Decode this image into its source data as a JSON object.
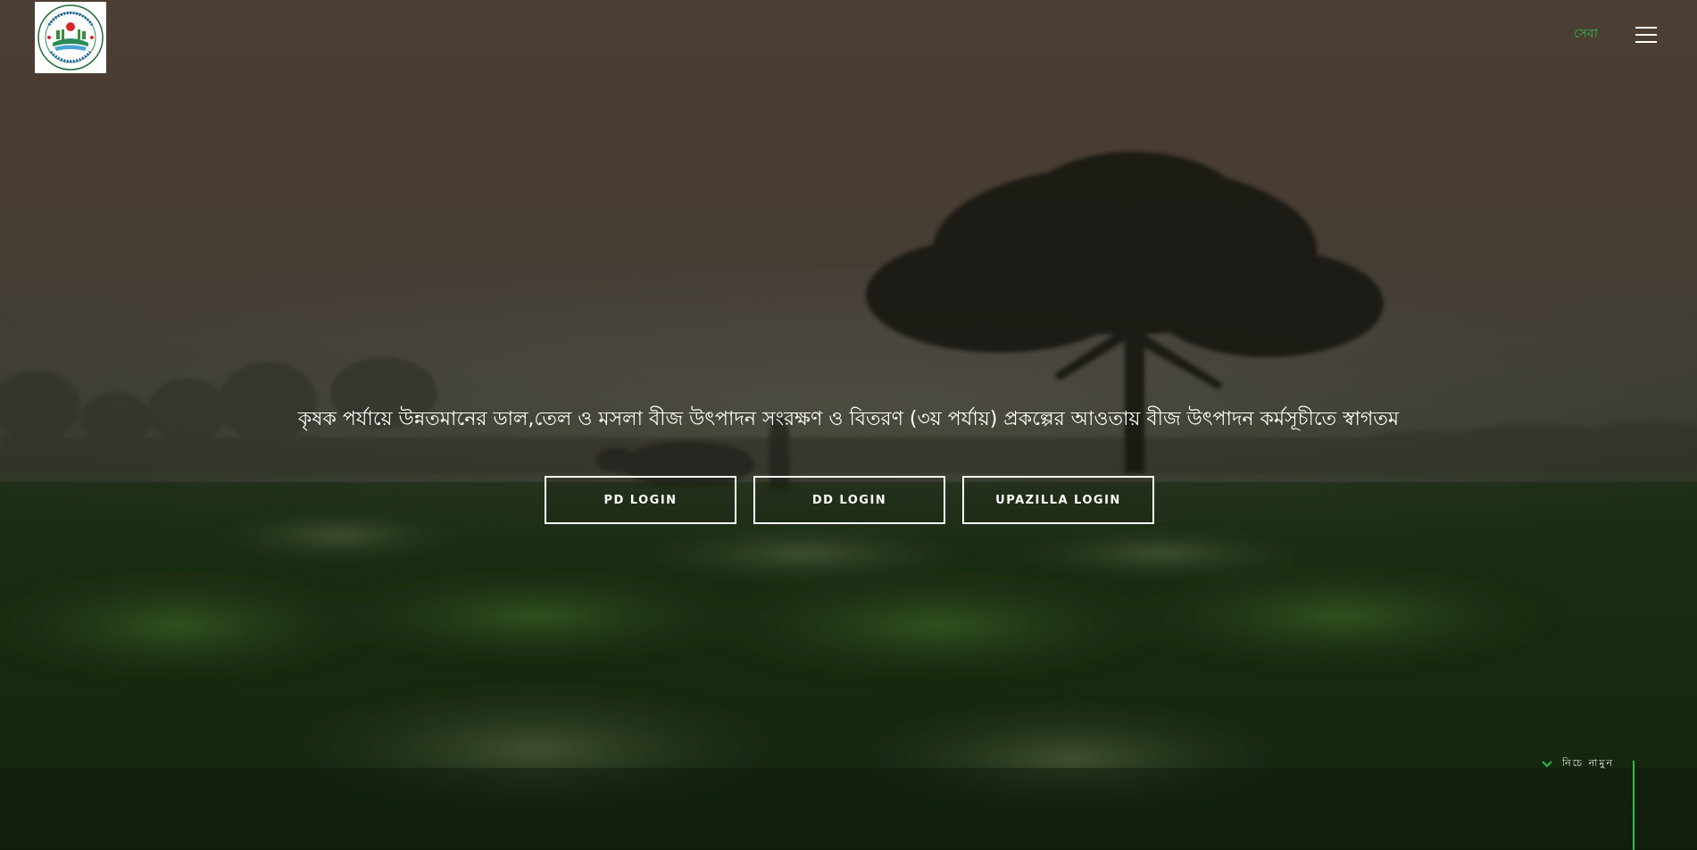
{
  "header": {
    "logo_alt": "Department of Agricultural Extension seal",
    "lang_link": "সেবা",
    "menu_icon": "hamburger-icon"
  },
  "hero": {
    "headline": "কৃষক পর্যায়ে উন্নতমানের ডাল,তেল ও মসলা বীজ উৎপাদন সংরক্ষণ ও বিতরণ (৩য় পর্যায়) প্রকল্পের আওতায় বীজ উৎপাদন কর্মসূচীতে স্বাগতম",
    "buttons": [
      {
        "label": "PD LOGIN"
      },
      {
        "label": "DD LOGIN"
      },
      {
        "label": "UPAZILLA LOGIN"
      }
    ]
  },
  "scroll": {
    "label": "নিচে নামুন",
    "icon": "chevron-down-icon"
  },
  "colors": {
    "accent": "#2bbf4a",
    "button_border": "#ffffff",
    "text": "#ffffff"
  }
}
